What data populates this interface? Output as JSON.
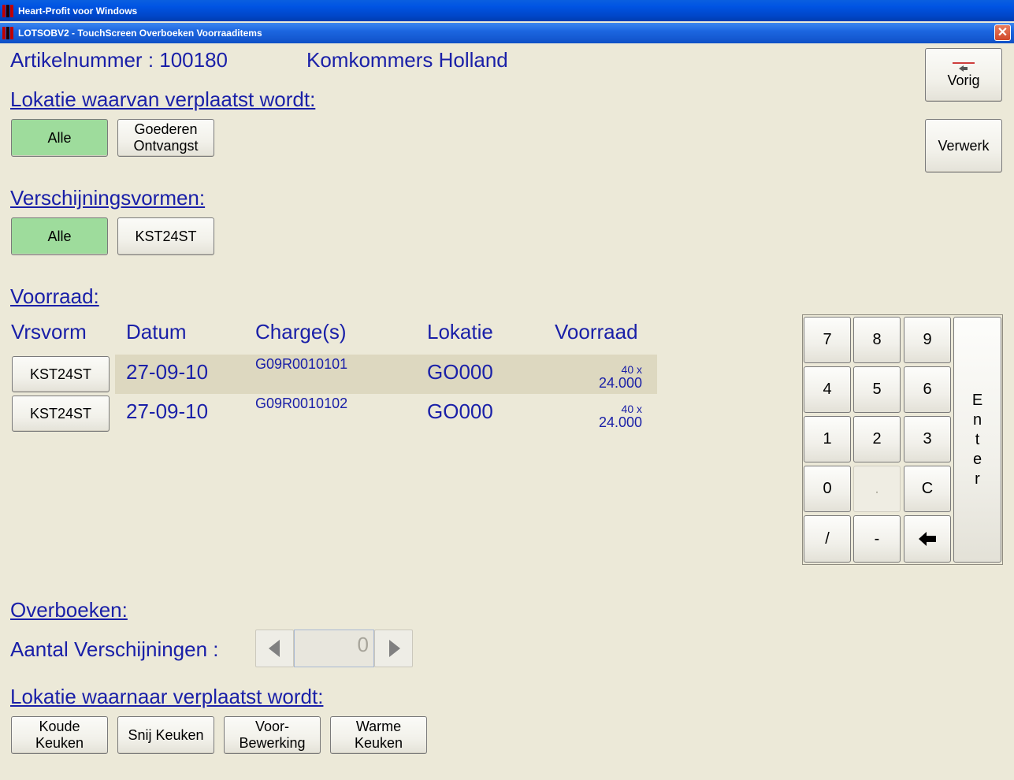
{
  "window": {
    "outer_title": "Heart-Profit voor Windows",
    "inner_title": "LOTSOBV2 - TouchScreen Overboeken Voorraaditems",
    "close_glyph": "✕"
  },
  "article": {
    "number_label": "Artikelnummer : 100180",
    "name": "Komkommers Holland"
  },
  "side_buttons": {
    "vorig": "Vorig",
    "verwerk": "Verwerk"
  },
  "source_location": {
    "title": "Lokatie waarvan verplaatst wordt:",
    "buttons": [
      "Alle",
      "Goederen\nOntvangst"
    ]
  },
  "forms": {
    "title": "Verschijningsvormen:",
    "buttons": [
      "Alle",
      "KST24ST"
    ]
  },
  "stock": {
    "title": "Voorraad:",
    "columns": [
      "Vrsvorm",
      "Datum",
      "Charge(s)",
      "Lokatie",
      "Voorraad"
    ],
    "rows": [
      {
        "form": "KST24ST",
        "date": "27-09-10",
        "charge": "G09R0010101",
        "location": "GO000",
        "qty_small": "40 x",
        "qty": "24.000"
      },
      {
        "form": "KST24ST",
        "date": "27-09-10",
        "charge": "G09R0010102",
        "location": "GO000",
        "qty_small": "40 x",
        "qty": "24.000"
      }
    ]
  },
  "keypad": {
    "keys": [
      "7",
      "8",
      "9",
      "4",
      "5",
      "6",
      "1",
      "2",
      "3",
      "0",
      ".",
      "C",
      "/",
      "-"
    ],
    "enter_letters": [
      "E",
      "n",
      "t",
      "e",
      "r"
    ]
  },
  "transfer": {
    "title": "Overboeken:",
    "count_label": "Aantal Verschijningen :",
    "count_value": "0"
  },
  "target_location": {
    "title": "Lokatie waarnaar verplaatst wordt:",
    "buttons": [
      "Koude\nKeuken",
      "Snij Keuken",
      "Voor-\nBewerking",
      "Warme\nKeuken"
    ]
  },
  "colors": {
    "text_blue": "#1A20A8",
    "selected_green": "#9EDC9C",
    "row_highlight": "#DDD8C0",
    "titlebar_blue": "#0054E3"
  }
}
